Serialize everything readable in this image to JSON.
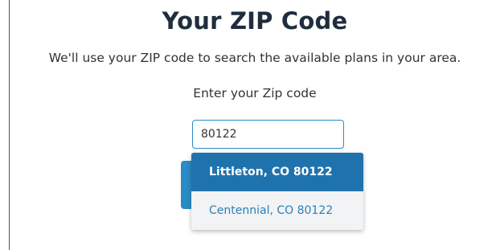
{
  "header": {
    "title": "Your ZIP Code",
    "subtitle": "We'll use your ZIP code to search the available plans in your area."
  },
  "zip": {
    "label": "Enter your Zip code",
    "value": "80122",
    "accent_color": "#2a8cc4"
  },
  "suggestions": {
    "items": [
      {
        "label": "Littleton, CO 80122",
        "state": "highlighted",
        "color": "#1f73ad"
      },
      {
        "label": "Centennial, CO 80122",
        "state": "normal",
        "color": "#2a7fb8"
      }
    ]
  }
}
